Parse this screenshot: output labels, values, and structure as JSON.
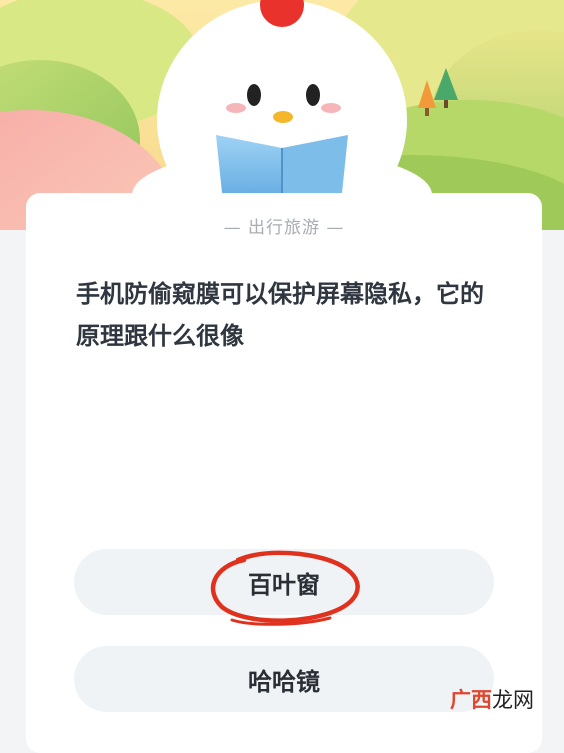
{
  "card": {
    "category": "— 出行旅游 —",
    "question": "手机防偷窥膜可以保护屏幕隐私，它的原理跟什么很像",
    "options": [
      {
        "label": "百叶窗",
        "annotated": true
      },
      {
        "label": "哈哈镜",
        "annotated": false
      }
    ]
  },
  "watermark": {
    "part1": "广西",
    "part2": "龙网"
  },
  "colors": {
    "annotation_circle": "#e0311e",
    "card_bg": "#ffffff",
    "option_bg": "#f0f3f6"
  }
}
